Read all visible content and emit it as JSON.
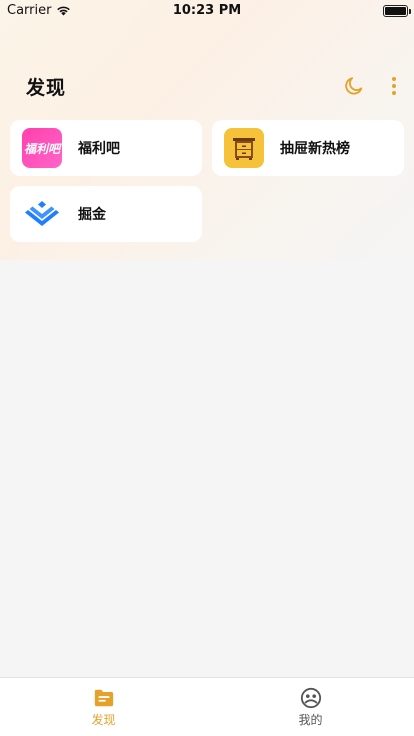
{
  "status_bar": {
    "carrier": "Carrier",
    "time": "10:23 PM"
  },
  "header": {
    "title": "发现"
  },
  "colors": {
    "accent": "#e5a22a",
    "card_bg": "#ffffff",
    "page_bg": "#f5f5f5"
  },
  "cards": [
    {
      "name": "福利吧",
      "logo_text": "福利吧",
      "icon": "fuliba-logo-icon"
    },
    {
      "name": "抽屉新热榜",
      "icon": "drawer-cabinet-icon"
    },
    {
      "name": "掘金",
      "icon": "juejin-logo-icon"
    }
  ],
  "tab_bar": {
    "tabs": [
      {
        "label": "发现",
        "icon": "folder-icon",
        "active": true
      },
      {
        "label": "我的",
        "icon": "profile-icon",
        "active": false
      }
    ]
  }
}
